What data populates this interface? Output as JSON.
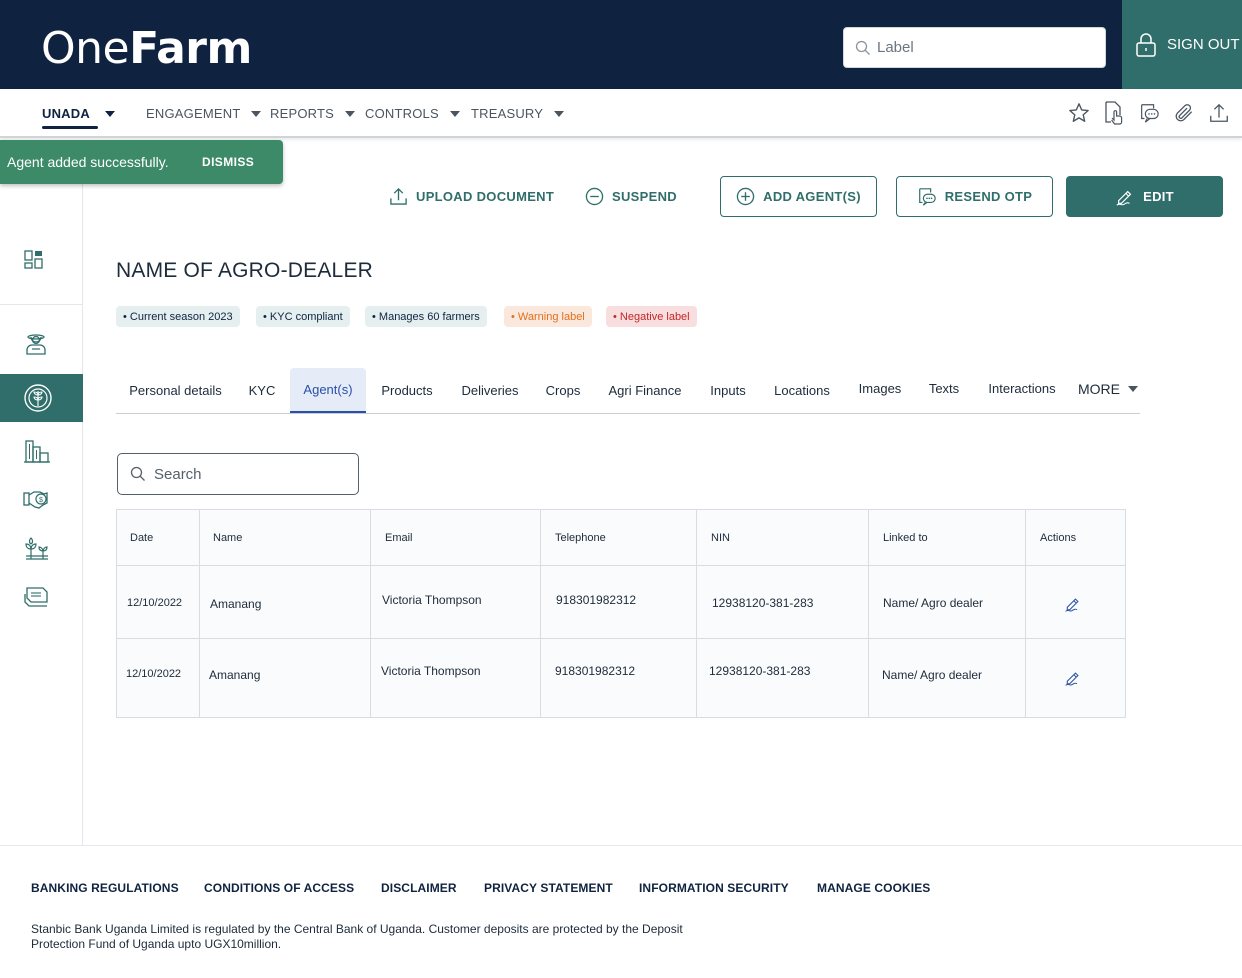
{
  "header": {
    "logo_one": "One",
    "logo_farm": "Farm",
    "search_placeholder": "Label",
    "sign_out": "SIGN OUT"
  },
  "nav": {
    "items": [
      {
        "label": "UNADA",
        "active": true
      },
      {
        "label": "ENGAGEMENT"
      },
      {
        "label": "REPORTS"
      },
      {
        "label": "CONTROLS"
      },
      {
        "label": "TREASURY"
      }
    ],
    "icons": [
      "star-icon",
      "document-touch-icon",
      "chat-icon",
      "paperclip-icon",
      "upload-icon"
    ]
  },
  "toast": {
    "message": "Agent added successfully.",
    "dismiss": "DISMISS"
  },
  "sidebar": {
    "items": [
      "dashboard-icon",
      "farmer-icon",
      "agro-dealer-icon",
      "buildings-icon",
      "handshake-icon",
      "plants-icon",
      "cash-icon"
    ]
  },
  "actions": {
    "upload_document": "UPLOAD DOCUMENT",
    "suspend": "SUSPEND",
    "add_agents": "ADD AGENT(S)",
    "resend_otp": "RESEND OTP",
    "edit": "EDIT"
  },
  "page_title": "NAME OF AGRO-DEALER",
  "chips": [
    {
      "label": "• Current season 2023",
      "kind": "neutral"
    },
    {
      "label": "• KYC compliant",
      "kind": "neutral"
    },
    {
      "label": "• Manages 60 farmers",
      "kind": "neutral"
    },
    {
      "label": "• Warning label",
      "kind": "warn"
    },
    {
      "label": "• Negative label",
      "kind": "neg"
    }
  ],
  "tabs": [
    "Personal details",
    "KYC",
    "Agent(s)",
    "Products",
    "Deliveries",
    "Crops",
    "Agri Finance",
    "Inputs",
    "Locations",
    "Images",
    "Texts",
    "Interactions",
    "MORE"
  ],
  "active_tab": "Agent(s)",
  "table": {
    "search_placeholder": "Search",
    "headers": [
      "Date",
      "Name",
      "Email",
      "Telephone",
      "NIN",
      "Linked to",
      "Actions"
    ],
    "rows": [
      {
        "date": "12/10/2022",
        "name": "Amanang",
        "email": "Victoria Thompson",
        "telephone": "918301982312",
        "nin": "12938120-381-283",
        "linked_to": "Name/ Agro dealer"
      },
      {
        "date": "12/10/2022",
        "name": "Amanang",
        "email": "Victoria Thompson",
        "telephone": "918301982312",
        "nin": "12938120-381-283",
        "linked_to": "Name/ Agro dealer"
      }
    ]
  },
  "footer": {
    "links": [
      "BANKING REGULATIONS",
      "CONDITIONS OF ACCESS",
      "DISCLAIMER",
      "PRIVACY STATEMENT",
      "INFORMATION SECURITY",
      "MANAGE COOKIES"
    ],
    "note": "Stanbic Bank Uganda Limited is regulated by the Central Bank of Uganda. Customer deposits are protected by the Deposit Protection Fund of Uganda upto UGX10million."
  },
  "colors": {
    "navy": "#0f2340",
    "teal": "#2f6e6a",
    "toast_green": "#3c8a68",
    "active_tab_blue": "#2850a8",
    "warning_orange": "#e0701f",
    "negative_red": "#c3282a"
  }
}
